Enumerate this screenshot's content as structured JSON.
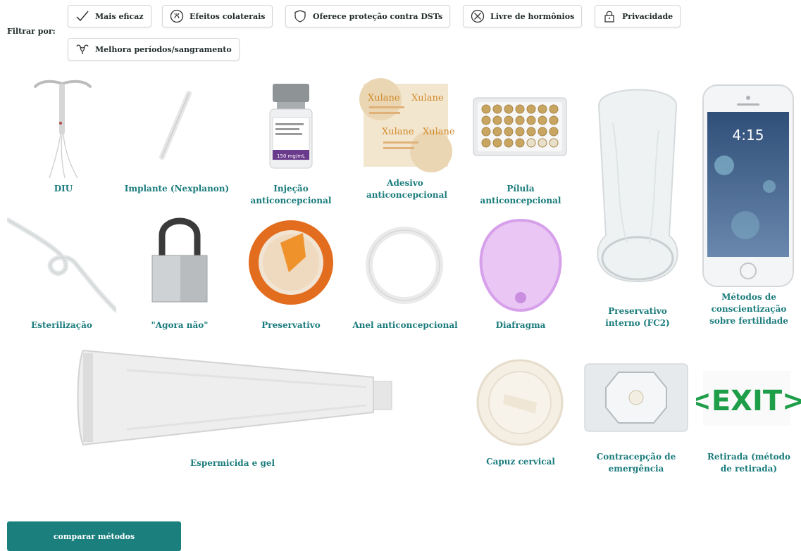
{
  "filters": {
    "label": "Filtrar por:",
    "chips": [
      {
        "label": "Mais eficaz",
        "icon": "check-icon"
      },
      {
        "label": "Efeitos colaterais",
        "icon": "side-effects-icon"
      },
      {
        "label": "Oferece proteção contra DSTs",
        "icon": "shield-icon"
      },
      {
        "label": "Livre de hormônios",
        "icon": "no-hormones-icon"
      },
      {
        "label": "Privacidade",
        "icon": "lock-icon"
      },
      {
        "label": "Melhora períodos/sangramento",
        "icon": "uterus-icon"
      }
    ]
  },
  "methods": [
    {
      "label": "DIU",
      "icon": "iud-image"
    },
    {
      "label": "Implante (Nexplanon)",
      "icon": "implant-image"
    },
    {
      "label": "Injeção anticoncepcional",
      "icon": "injection-vial-image",
      "vial_text": "150 mg/mL"
    },
    {
      "label": "Adesivo anticoncepcional",
      "icon": "patch-image",
      "patch_text": "Xulane"
    },
    {
      "label": "Pílula anticoncepcional",
      "icon": "pill-pack-image"
    },
    {
      "label": "Preservativo interno (FC2)",
      "icon": "internal-condom-image"
    },
    {
      "label": "Métodos de conscientização sobre fertilidade",
      "icon": "smartphone-image",
      "phone_time": "4:15"
    },
    {
      "label": "Esterilização",
      "icon": "tied-cord-image"
    },
    {
      "label": "\"Agora não\"",
      "icon": "padlock-image"
    },
    {
      "label": "Preservativo",
      "icon": "condom-image"
    },
    {
      "label": "Anel anticoncepcional",
      "icon": "ring-image"
    },
    {
      "label": "Diafragma",
      "icon": "diaphragm-image"
    },
    {
      "label": "Espermicida e gel",
      "icon": "tube-image"
    },
    {
      "label": "Capuz cervical",
      "icon": "cervical-cap-image"
    },
    {
      "label": "Contracepção de emergência",
      "icon": "emergency-pill-image"
    },
    {
      "label": "Retirada (método de retirada)",
      "icon": "exit-sign-image",
      "sign_text": "<EXIT>"
    }
  ],
  "compare_button": {
    "label": "comparar métodos"
  },
  "colors": {
    "accent": "#1c7c7d",
    "button": "#1a7f7d",
    "exit_green": "#1f9e4a"
  }
}
